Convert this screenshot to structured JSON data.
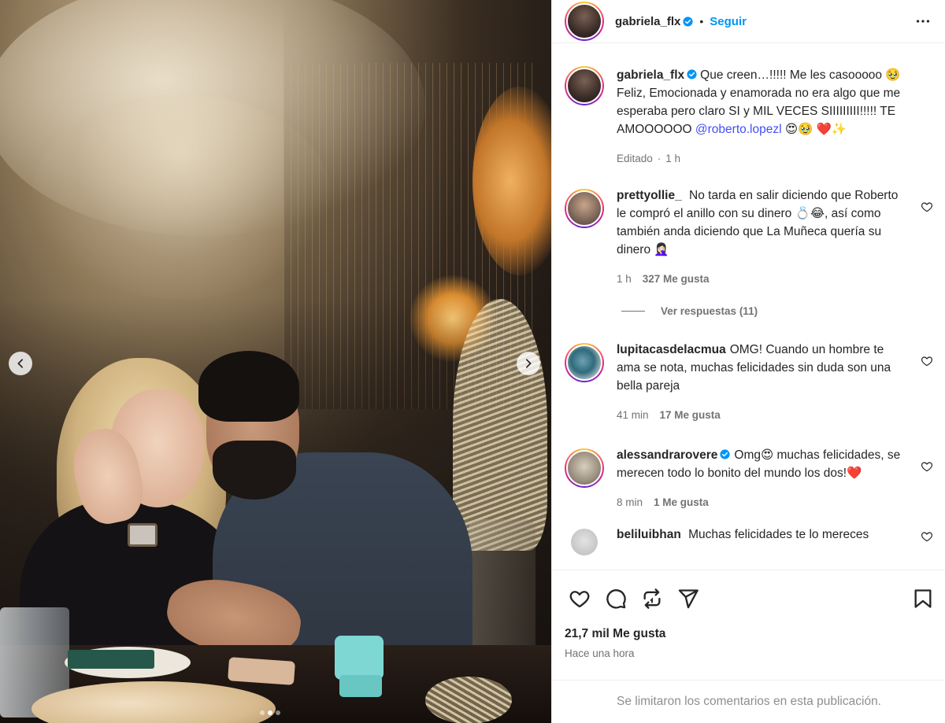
{
  "post": {
    "author": "gabriela_flx",
    "follow_label": "Seguir",
    "header_separator": "•"
  },
  "caption": {
    "username": "gabriela_flx",
    "text_part1": "Que creen…!!!!! Me les casooooo 🥹 Feliz, Emocionada y enamorada no era algo que me esperaba pero claro SI y MIL VECES SIIIIIIIII!!!!! TE AMOOOOOO ",
    "mention": "@roberto.lopezl",
    "text_part2": " 😍🥹 ❤️✨",
    "edited": "Editado",
    "time": "1 h"
  },
  "comments": [
    {
      "username": "prettyollie_",
      "text": "No tarda en salir diciendo que Roberto le compró el anillo con su dinero 💍😂, así como también anda diciendo que La Muñeca quería su dinero 🤦🏻‍♀️",
      "time": "1 h",
      "likes": "327 Me gusta",
      "replies": "Ver respuestas (11)"
    },
    {
      "username": "lupitacasdelacmua",
      "text": "OMG! Cuando un hombre te ama se nota, muchas felicidades sin duda son una bella pareja",
      "time": "41 min",
      "likes": "17 Me gusta"
    },
    {
      "username": "alessandrarovere",
      "text": "Omg😍 muchas felicidades, se merecen todo lo bonito del mundo los dos!❤️",
      "time": "8 min",
      "likes": "1 Me gusta"
    },
    {
      "username": "beliluibhan",
      "text": "Muchas felicidades te lo mereces"
    }
  ],
  "footer": {
    "likes_count": "21,7 mil Me gusta",
    "posted": "Hace una hora",
    "comments_limited": "Se limitaron los comentarios en esta publicación."
  },
  "carousel": {
    "total": 3,
    "active": 2
  },
  "colors": {
    "accent": "#0095f6",
    "mention": "#4150f7",
    "muted": "#737373",
    "text": "#262626"
  },
  "icons": [
    "chevron-left-icon",
    "chevron-right-icon",
    "more-options-icon",
    "verified-badge-icon",
    "heart-icon",
    "comment-icon",
    "share-icon",
    "send-icon",
    "save-icon"
  ]
}
